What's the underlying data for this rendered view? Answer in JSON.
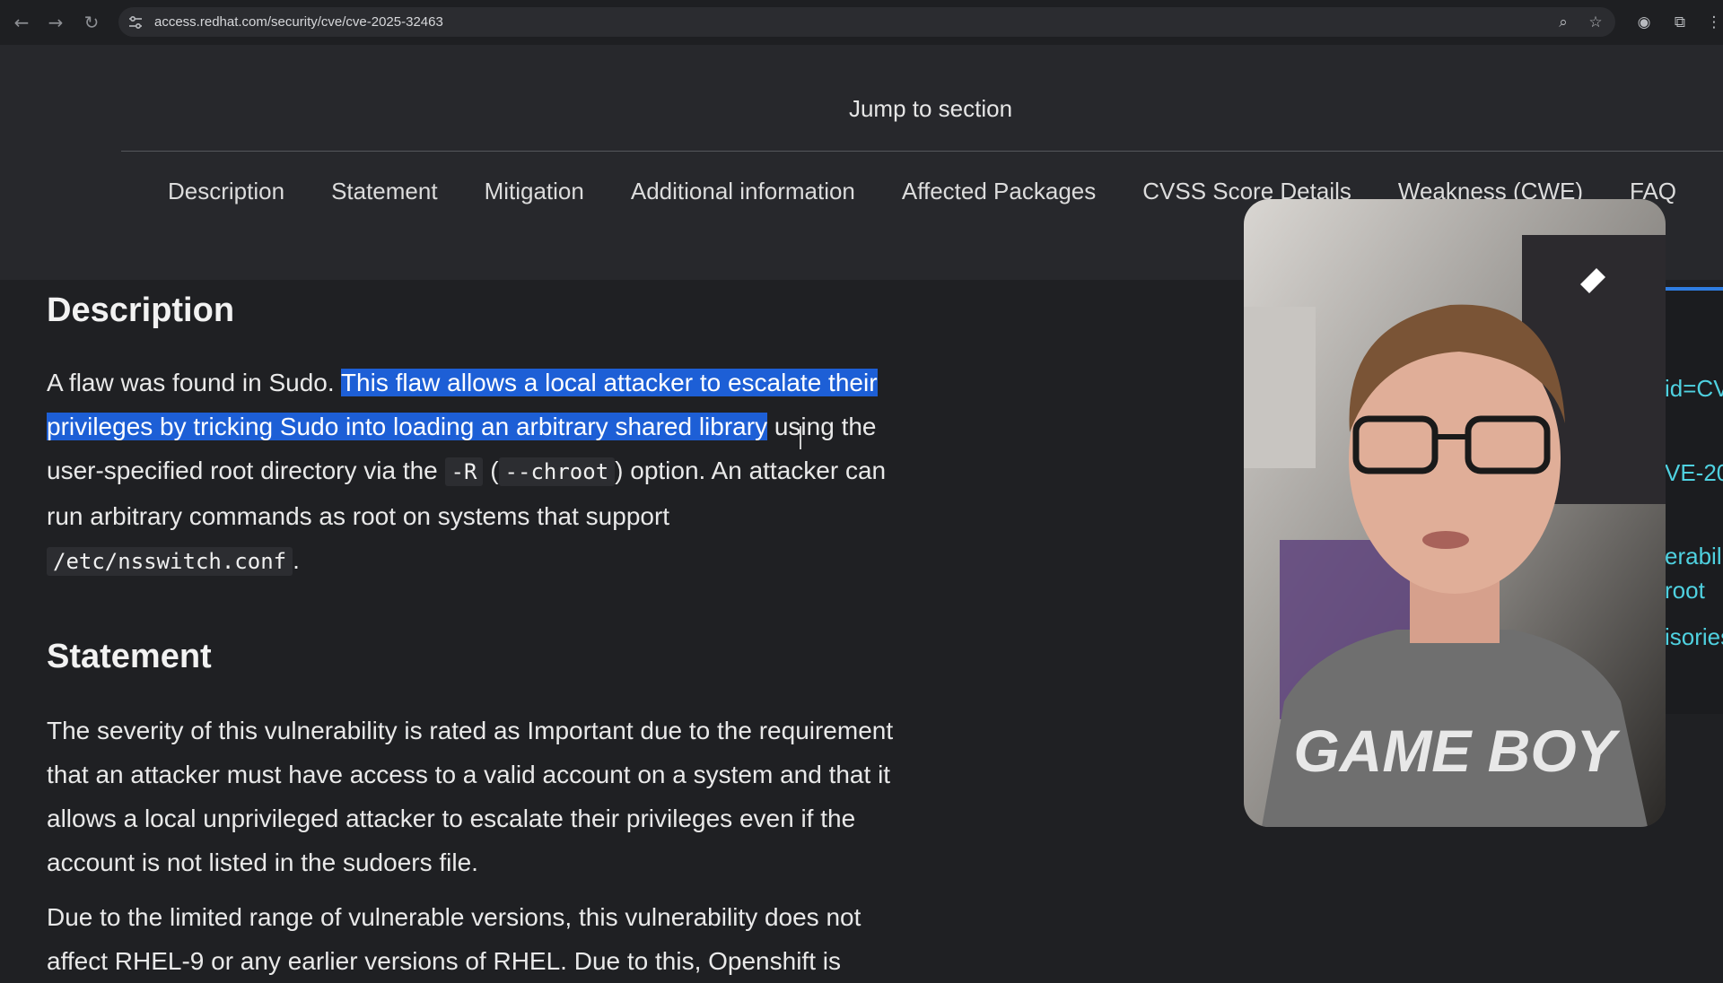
{
  "browser": {
    "url": "access.redhat.com/security/cve/cve-2025-32463"
  },
  "jump": {
    "title": "Jump to section",
    "links": [
      "Description",
      "Statement",
      "Mitigation",
      "Additional information",
      "Affected Packages",
      "CVSS Score Details",
      "Weakness (CWE)",
      "FAQ"
    ]
  },
  "description": {
    "heading": "Description",
    "text_before": "A flaw was found in Sudo. ",
    "highlighted": "This flaw allows a local attacker to escalate their privileges by tricking Sudo into loading an arbitrary shared library",
    "text_after_1": " using the user-specified root directory via the ",
    "code_r": "-R",
    "text_open_paren": " (",
    "code_chroot": "--chroot",
    "text_after_2": ") option. An attacker can run arbitrary commands as root on systems that support ",
    "code_nsswitch": "/etc/nsswitch.conf",
    "text_end": "."
  },
  "statement": {
    "heading": "Statement",
    "para1": "The severity of this vulnerability is rated as Important due to the requirement that an attacker must have access to a valid account on a system and that it allows a local unprivileged attacker to escalate their privileges even if the account is not listed in the sudoers file.",
    "para2": "Due to the limited range of vulnerable versions, this vulnerability does not affect RHEL-9 or any earlier versions of RHEL. Due to this, Openshift is"
  },
  "sidebar_fragments": [
    "id=CV",
    "VE-20",
    "erabili",
    "root",
    "isories"
  ],
  "webcam": {
    "shirt_text": "GAME BOY"
  },
  "colors": {
    "highlight": "#1d5fd6",
    "link": "#4fd1e0",
    "accent": "#2f7de1"
  }
}
